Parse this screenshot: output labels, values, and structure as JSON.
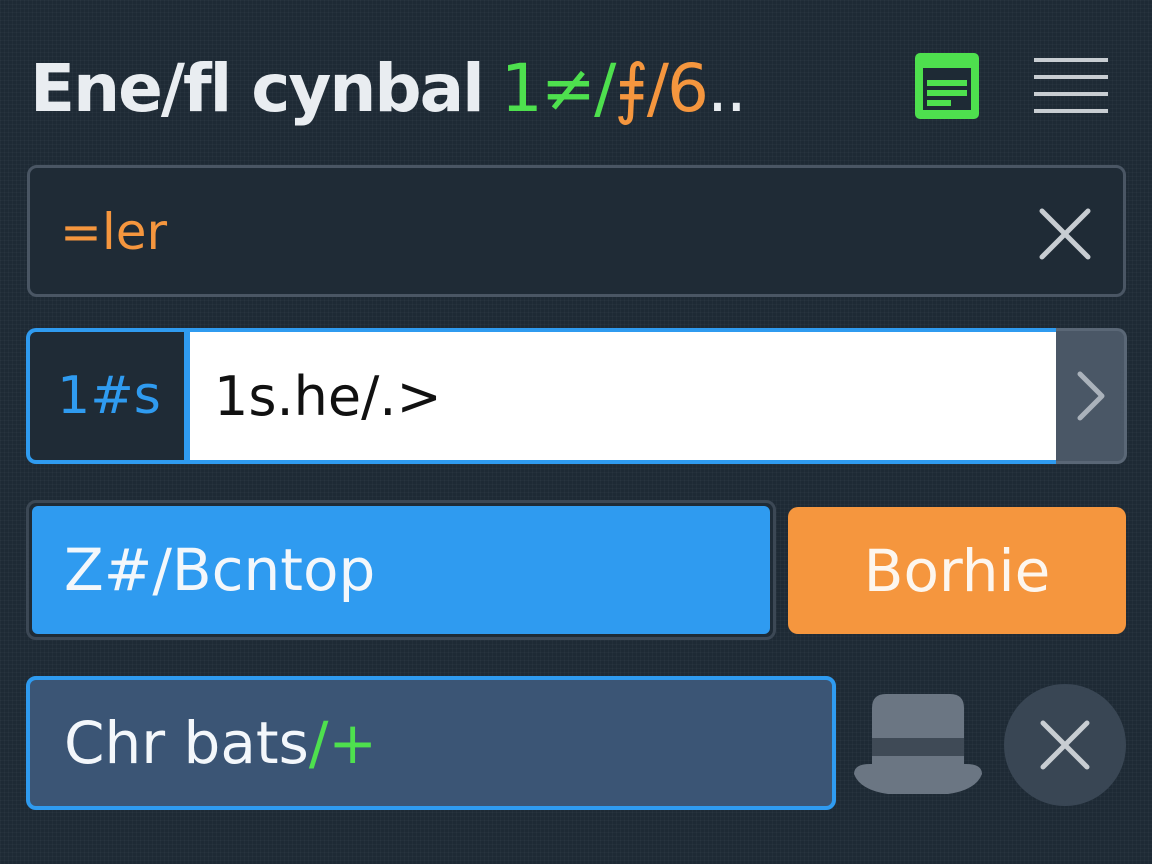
{
  "header": {
    "title_main": "Ene/fl cynbal",
    "title_green": "1≠/",
    "title_orange": "⨎/6",
    "title_tail": "..",
    "icons": [
      "document-icon",
      "hamburger-menu-icon"
    ]
  },
  "search": {
    "value": "=ler",
    "clear_icon": "close-icon"
  },
  "path": {
    "prefix": "1#s",
    "value": "1s.he/.>",
    "go_icon": "chevron-right-icon"
  },
  "actions": {
    "primary_label": "Z#/Bcntop",
    "secondary_label": "Borhie"
  },
  "bottom": {
    "field_text": "Chr bats",
    "field_suffix": "/+",
    "icons": [
      "hat-icon",
      "close-icon"
    ]
  },
  "colors": {
    "background": "#1e2a35",
    "accent_blue": "#2f9bf0",
    "accent_orange": "#f5963e",
    "accent_green": "#4ee04e",
    "field_blue": "#3b5575"
  }
}
